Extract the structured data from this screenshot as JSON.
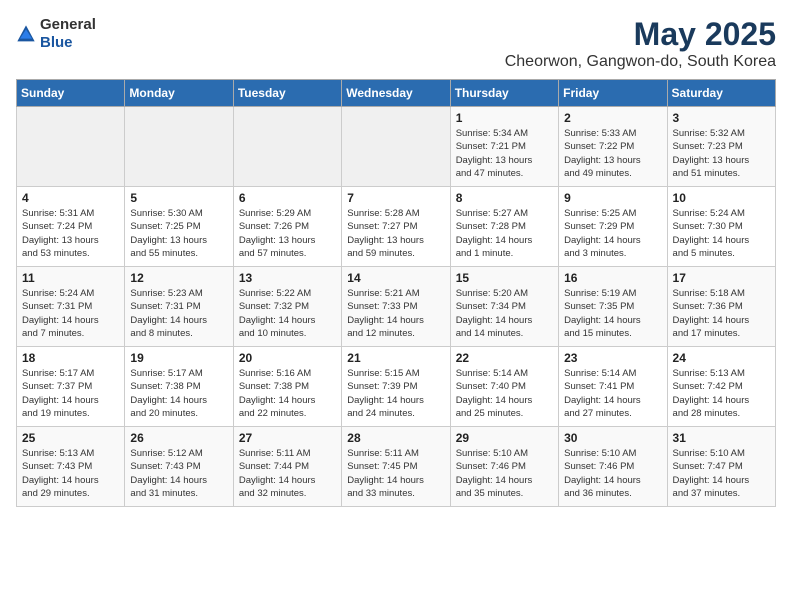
{
  "logo": {
    "general": "General",
    "blue": "Blue"
  },
  "title": "May 2025",
  "subtitle": "Cheorwon, Gangwon-do, South Korea",
  "days_of_week": [
    "Sunday",
    "Monday",
    "Tuesday",
    "Wednesday",
    "Thursday",
    "Friday",
    "Saturday"
  ],
  "weeks": [
    [
      {
        "day": "",
        "detail": ""
      },
      {
        "day": "",
        "detail": ""
      },
      {
        "day": "",
        "detail": ""
      },
      {
        "day": "",
        "detail": ""
      },
      {
        "day": "1",
        "detail": "Sunrise: 5:34 AM\nSunset: 7:21 PM\nDaylight: 13 hours\nand 47 minutes."
      },
      {
        "day": "2",
        "detail": "Sunrise: 5:33 AM\nSunset: 7:22 PM\nDaylight: 13 hours\nand 49 minutes."
      },
      {
        "day": "3",
        "detail": "Sunrise: 5:32 AM\nSunset: 7:23 PM\nDaylight: 13 hours\nand 51 minutes."
      }
    ],
    [
      {
        "day": "4",
        "detail": "Sunrise: 5:31 AM\nSunset: 7:24 PM\nDaylight: 13 hours\nand 53 minutes."
      },
      {
        "day": "5",
        "detail": "Sunrise: 5:30 AM\nSunset: 7:25 PM\nDaylight: 13 hours\nand 55 minutes."
      },
      {
        "day": "6",
        "detail": "Sunrise: 5:29 AM\nSunset: 7:26 PM\nDaylight: 13 hours\nand 57 minutes."
      },
      {
        "day": "7",
        "detail": "Sunrise: 5:28 AM\nSunset: 7:27 PM\nDaylight: 13 hours\nand 59 minutes."
      },
      {
        "day": "8",
        "detail": "Sunrise: 5:27 AM\nSunset: 7:28 PM\nDaylight: 14 hours\nand 1 minute."
      },
      {
        "day": "9",
        "detail": "Sunrise: 5:25 AM\nSunset: 7:29 PM\nDaylight: 14 hours\nand 3 minutes."
      },
      {
        "day": "10",
        "detail": "Sunrise: 5:24 AM\nSunset: 7:30 PM\nDaylight: 14 hours\nand 5 minutes."
      }
    ],
    [
      {
        "day": "11",
        "detail": "Sunrise: 5:24 AM\nSunset: 7:31 PM\nDaylight: 14 hours\nand 7 minutes."
      },
      {
        "day": "12",
        "detail": "Sunrise: 5:23 AM\nSunset: 7:31 PM\nDaylight: 14 hours\nand 8 minutes."
      },
      {
        "day": "13",
        "detail": "Sunrise: 5:22 AM\nSunset: 7:32 PM\nDaylight: 14 hours\nand 10 minutes."
      },
      {
        "day": "14",
        "detail": "Sunrise: 5:21 AM\nSunset: 7:33 PM\nDaylight: 14 hours\nand 12 minutes."
      },
      {
        "day": "15",
        "detail": "Sunrise: 5:20 AM\nSunset: 7:34 PM\nDaylight: 14 hours\nand 14 minutes."
      },
      {
        "day": "16",
        "detail": "Sunrise: 5:19 AM\nSunset: 7:35 PM\nDaylight: 14 hours\nand 15 minutes."
      },
      {
        "day": "17",
        "detail": "Sunrise: 5:18 AM\nSunset: 7:36 PM\nDaylight: 14 hours\nand 17 minutes."
      }
    ],
    [
      {
        "day": "18",
        "detail": "Sunrise: 5:17 AM\nSunset: 7:37 PM\nDaylight: 14 hours\nand 19 minutes."
      },
      {
        "day": "19",
        "detail": "Sunrise: 5:17 AM\nSunset: 7:38 PM\nDaylight: 14 hours\nand 20 minutes."
      },
      {
        "day": "20",
        "detail": "Sunrise: 5:16 AM\nSunset: 7:38 PM\nDaylight: 14 hours\nand 22 minutes."
      },
      {
        "day": "21",
        "detail": "Sunrise: 5:15 AM\nSunset: 7:39 PM\nDaylight: 14 hours\nand 24 minutes."
      },
      {
        "day": "22",
        "detail": "Sunrise: 5:14 AM\nSunset: 7:40 PM\nDaylight: 14 hours\nand 25 minutes."
      },
      {
        "day": "23",
        "detail": "Sunrise: 5:14 AM\nSunset: 7:41 PM\nDaylight: 14 hours\nand 27 minutes."
      },
      {
        "day": "24",
        "detail": "Sunrise: 5:13 AM\nSunset: 7:42 PM\nDaylight: 14 hours\nand 28 minutes."
      }
    ],
    [
      {
        "day": "25",
        "detail": "Sunrise: 5:13 AM\nSunset: 7:43 PM\nDaylight: 14 hours\nand 29 minutes."
      },
      {
        "day": "26",
        "detail": "Sunrise: 5:12 AM\nSunset: 7:43 PM\nDaylight: 14 hours\nand 31 minutes."
      },
      {
        "day": "27",
        "detail": "Sunrise: 5:11 AM\nSunset: 7:44 PM\nDaylight: 14 hours\nand 32 minutes."
      },
      {
        "day": "28",
        "detail": "Sunrise: 5:11 AM\nSunset: 7:45 PM\nDaylight: 14 hours\nand 33 minutes."
      },
      {
        "day": "29",
        "detail": "Sunrise: 5:10 AM\nSunset: 7:46 PM\nDaylight: 14 hours\nand 35 minutes."
      },
      {
        "day": "30",
        "detail": "Sunrise: 5:10 AM\nSunset: 7:46 PM\nDaylight: 14 hours\nand 36 minutes."
      },
      {
        "day": "31",
        "detail": "Sunrise: 5:10 AM\nSunset: 7:47 PM\nDaylight: 14 hours\nand 37 minutes."
      }
    ]
  ]
}
